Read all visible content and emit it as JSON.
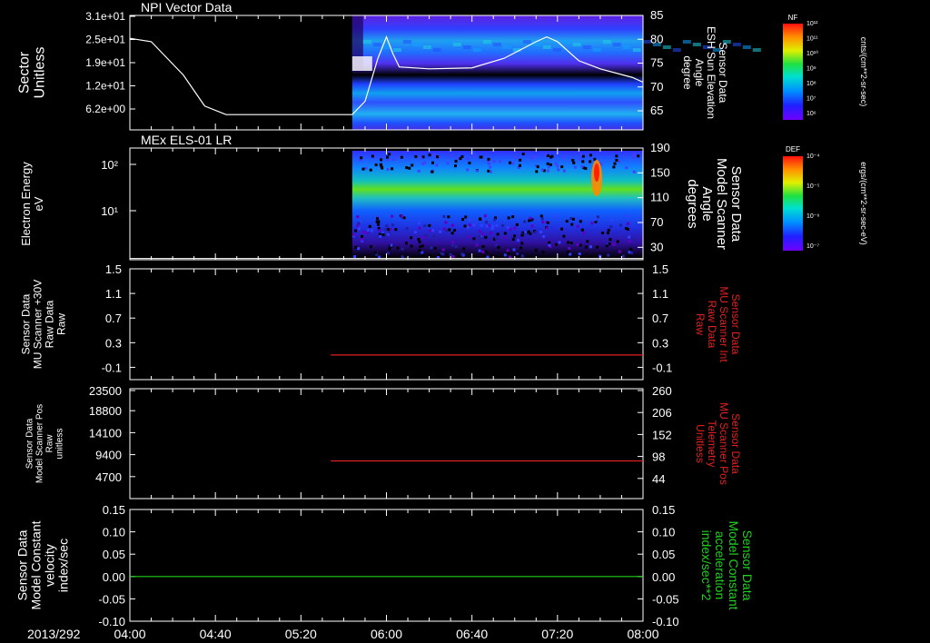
{
  "date_label": "2013/292",
  "time_ticks": [
    "04:00",
    "04:40",
    "05:20",
    "06:00",
    "06:40",
    "07:20",
    "08:00"
  ],
  "colors": {
    "background": "#000000",
    "axis": "#ffffff",
    "red_trace": "#e02020",
    "green_trace": "#20d020"
  },
  "chart_data": [
    {
      "type": "heatmap",
      "title": "NPI Vector Data",
      "ylabel": [
        "Sector",
        "Unitless"
      ],
      "ytick_labels": [
        "3.1e+01",
        "2.5e+01",
        "1.9e+01",
        "1.2e+01",
        "6.2e+00"
      ],
      "right_ylabel": [
        "Sensor Data",
        "ESH Sun Elevation",
        "Angle",
        "degree"
      ],
      "right_ylim": [
        61,
        85
      ],
      "right_ticks": [
        85,
        80,
        75,
        70,
        65
      ],
      "colorbar": {
        "title": "NF",
        "unit": "cnts/(cm**2-sr-sec)",
        "tick_labels": [
          "10¹²",
          "10¹¹",
          "10¹⁰",
          "10⁹",
          "10⁸",
          "10⁷",
          "10⁶"
        ]
      },
      "overlay_line": {
        "name": "ESH Sun Elevation Angle",
        "points": [
          [
            "04:00",
            80.2
          ],
          [
            "04:10",
            79.5
          ],
          [
            "04:25",
            72.5
          ],
          [
            "04:35",
            66
          ],
          [
            "04:45",
            64.2
          ],
          [
            "05:00",
            64.2
          ],
          [
            "05:30",
            64.2
          ],
          [
            "05:44",
            64.2
          ],
          [
            "05:50",
            67
          ],
          [
            "05:56",
            76
          ],
          [
            "06:00",
            80.5
          ],
          [
            "06:03",
            77
          ],
          [
            "06:06",
            74.2
          ],
          [
            "06:20",
            73.8
          ],
          [
            "06:40",
            74
          ],
          [
            "06:55",
            76
          ],
          [
            "07:10",
            79.5
          ],
          [
            "07:15",
            80.5
          ],
          [
            "07:20",
            79.5
          ],
          [
            "07:30",
            75.5
          ],
          [
            "07:40",
            73.8
          ],
          [
            "07:55",
            72
          ],
          [
            "08:00",
            71
          ]
        ]
      },
      "data_start": "05:44"
    },
    {
      "type": "heatmap",
      "title": "MEx ELS-01 LR",
      "ylabel": [
        "Electron Energy",
        "eV"
      ],
      "ytick_labels": [
        "10²",
        "10¹"
      ],
      "right_ylabel": [
        "Sensor Data",
        "Model Scanner",
        "Angle",
        "degrees"
      ],
      "right_ylim": [
        10,
        190
      ],
      "right_ticks": [
        190,
        150,
        110,
        70,
        30
      ],
      "colorbar": {
        "title": "DEF",
        "unit": "ergs/(cm**2-sr-sec-eV)",
        "tick_labels": [
          "10⁻⁴",
          "10⁻⁵",
          "10⁻⁶",
          "10⁻⁷"
        ]
      },
      "overlay_line": {
        "name": "Model Scanner Angle",
        "points": [
          [
            "04:00",
            12
          ],
          [
            "08:00",
            12
          ]
        ]
      },
      "data_start": "05:44"
    },
    {
      "type": "line",
      "ylabel": [
        "Sensor Data",
        "MU Scanner +30V",
        "Raw Data",
        "Raw"
      ],
      "ylim": [
        -0.3,
        1.5
      ],
      "ytick_labels": [
        "1.5",
        "1.1",
        "0.7",
        "0.3",
        "-0.1"
      ],
      "yticks": [
        1.5,
        1.1,
        0.7,
        0.3,
        -0.1
      ],
      "right_ylabel": [
        "Sensor Data",
        "MU Scanner Int",
        "Raw Data",
        "Raw"
      ],
      "right_ytick_labels": [
        "1.5",
        "1.1",
        "0.7",
        "0.3",
        "-0.1"
      ],
      "series": [
        {
          "name": "MU Scanner Int",
          "x": [
            "05:34",
            "08:00"
          ],
          "values": [
            0.1,
            0.1
          ]
        }
      ]
    },
    {
      "type": "line",
      "ylabel": [
        "Sensor Data",
        "Model Scanner Pos",
        "Raw",
        "unitless"
      ],
      "ylim": [
        0,
        23500
      ],
      "ytick_labels": [
        "23500",
        "18800",
        "14100",
        "9400",
        "4700"
      ],
      "yticks": [
        23500,
        18800,
        14100,
        9400,
        4700
      ],
      "right_ylabel": [
        "Sensor Data",
        "MU Scanner Pos",
        "Telemetry",
        "Unitless"
      ],
      "right_ylim": [
        -10,
        260
      ],
      "right_ticks": [
        260,
        206,
        152,
        98,
        44
      ],
      "series": [
        {
          "name": "MU Scanner Pos Telemetry",
          "x": [
            "05:34",
            "08:00"
          ],
          "values": [
            87,
            87
          ]
        }
      ]
    },
    {
      "type": "line",
      "ylabel": [
        "Sensor Data",
        "Model Constant",
        "velocity",
        "index/sec"
      ],
      "ylim": [
        -0.1,
        0.15
      ],
      "ytick_labels": [
        "0.15",
        "0.10",
        "0.05",
        "0.00",
        "-0.05",
        "-0.10"
      ],
      "yticks": [
        0.15,
        0.1,
        0.05,
        0.0,
        -0.05,
        -0.1
      ],
      "right_ylabel": [
        "Sensor Data",
        "Model Constant",
        "acceleration",
        "index/sec**2"
      ],
      "series": [
        {
          "name": "Model Constant acceleration",
          "x": [
            "04:00",
            "08:00"
          ],
          "values": [
            0.0,
            0.0
          ]
        }
      ]
    }
  ]
}
